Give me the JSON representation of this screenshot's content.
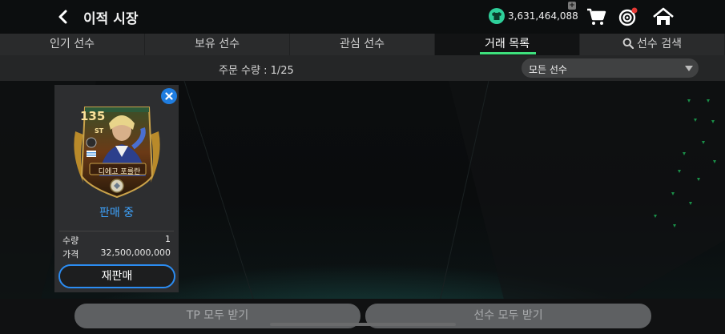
{
  "header": {
    "title": "이적 시장",
    "currency_value": "3,631,464,088",
    "plus_label": "+"
  },
  "tabs": [
    {
      "label": "인기 선수",
      "active": false
    },
    {
      "label": "보유 선수",
      "active": false
    },
    {
      "label": "관심 선수",
      "active": false
    },
    {
      "label": "거래 목록",
      "active": true
    },
    {
      "label": "선수 검색",
      "active": false
    }
  ],
  "subbar": {
    "order_count": "주문 수량 : 1/25",
    "filter_selected": "모든 선수"
  },
  "listing": {
    "overall": "135",
    "position": "ST",
    "player_name": "디에고 포를란",
    "status": "판매 중",
    "quantity_label": "수량",
    "quantity_value": "1",
    "price_label": "가격",
    "price_value": "32,500,000,000",
    "resell_label": "재판매"
  },
  "bottom": {
    "tp_receive_all": "TP 모두 받기",
    "players_receive_all": "선수 모두 받기"
  },
  "colors": {
    "accent_green": "#3ee07d",
    "accent_blue": "#2b8cf2",
    "status_blue": "#3ea4ff",
    "notification_red": "#e53935"
  },
  "icons": [
    "back-arrow-icon",
    "coin-shirt-icon",
    "cart-icon",
    "target-icon",
    "home-icon",
    "search-icon",
    "close-icon",
    "chevron-down-icon"
  ]
}
